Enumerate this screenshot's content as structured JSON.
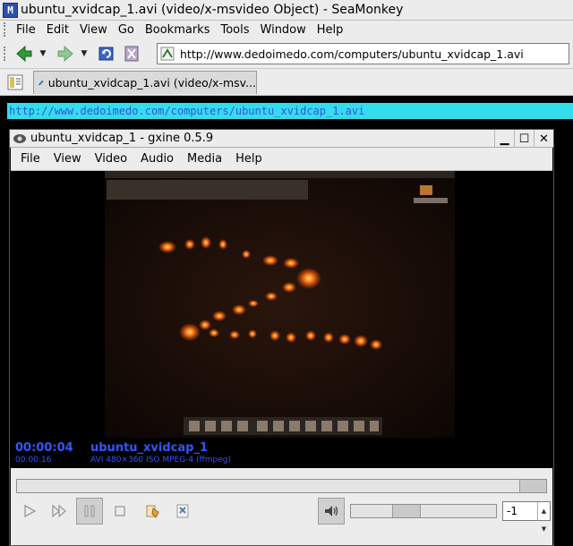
{
  "seamonkey": {
    "title": "ubuntu_xvidcap_1.avi (video/x-msvideo Object) - SeaMonkey",
    "menu": [
      "File",
      "Edit",
      "View",
      "Go",
      "Bookmarks",
      "Tools",
      "Window",
      "Help"
    ],
    "url": "http://www.dedoimedo.com/computers/ubuntu_xvidcap_1.avi",
    "tab_label": "ubuntu_xvidcap_1.avi (video/x-msv...",
    "plugin_url": "http://www.dedoimedo.com/computers/ubuntu_xvidcap_1.avi"
  },
  "gxine": {
    "title": "ubuntu_xvidcap_1 - gxine 0.5.9",
    "menu": [
      "File",
      "View",
      "Video",
      "Audio",
      "Media",
      "Help"
    ],
    "time_current": "00:00:04",
    "time_total": "00:00:16",
    "stream_title": "ubuntu_xvidcap_1",
    "stream_info": "AVI 480×360 ISO MPEG-4 (ffmpeg)",
    "seek_fraction": 1.0,
    "volume_fraction": 0.35,
    "spin_value": "-1"
  },
  "icons": {
    "app": "seamonkey-icon",
    "back": "back-icon",
    "forward": "forward-icon",
    "reload": "reload-icon",
    "stop": "stop-icon"
  }
}
